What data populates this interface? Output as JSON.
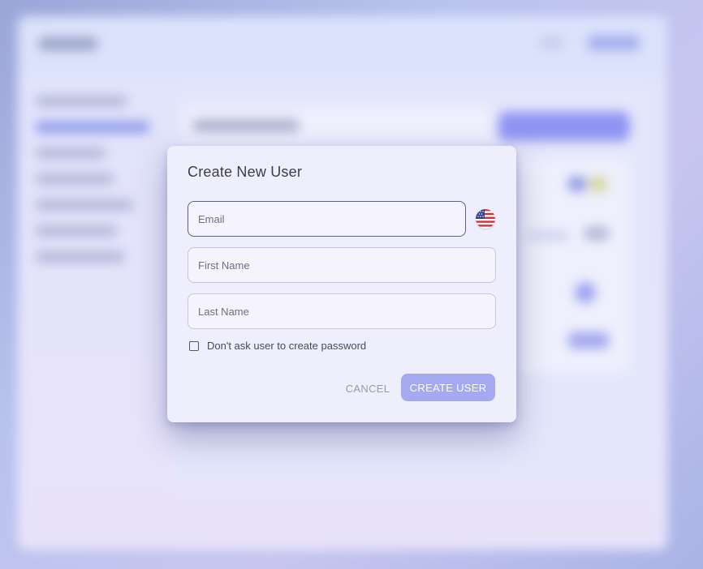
{
  "dialog": {
    "title": "Create New User",
    "email_placeholder": "Email",
    "first_name_placeholder": "First Name",
    "last_name_placeholder": "Last Name",
    "country_icon": "us-flag-icon",
    "checkbox_label": "Don't ask user to create password",
    "checkbox_checked": false,
    "cancel_label": "CANCEL",
    "create_label": "CREATE USER"
  },
  "colors": {
    "accent": "#a5a9f2",
    "dialog_bg": "#eeeefc",
    "focus_border": "#5a5f8e"
  }
}
